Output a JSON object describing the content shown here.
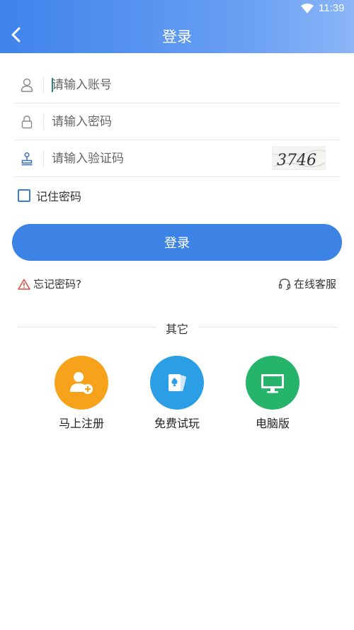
{
  "status_bar": {
    "time": "11:39"
  },
  "header": {
    "title": "登录"
  },
  "form": {
    "account_placeholder": "请输入账号",
    "password_placeholder": "请输入密码",
    "captcha_placeholder": "请输入验证码",
    "captcha_text": "3746",
    "remember_label": "记住密码",
    "login_label": "登录"
  },
  "links": {
    "forgot_password": "忘记密码?",
    "customer_service": "在线客服"
  },
  "other": {
    "title": "其它",
    "options": [
      {
        "label": "马上注册",
        "icon": "add-user-icon",
        "color": "#f7a21b"
      },
      {
        "label": "免费试玩",
        "icon": "cards-icon",
        "color": "#2b9ee6"
      },
      {
        "label": "电脑版",
        "icon": "monitor-icon",
        "color": "#25b46a"
      }
    ]
  },
  "colors": {
    "header_start": "#3f83ec",
    "header_end": "#8bb6f7",
    "primary": "#3d83e6",
    "warning": "#e04b3a"
  }
}
